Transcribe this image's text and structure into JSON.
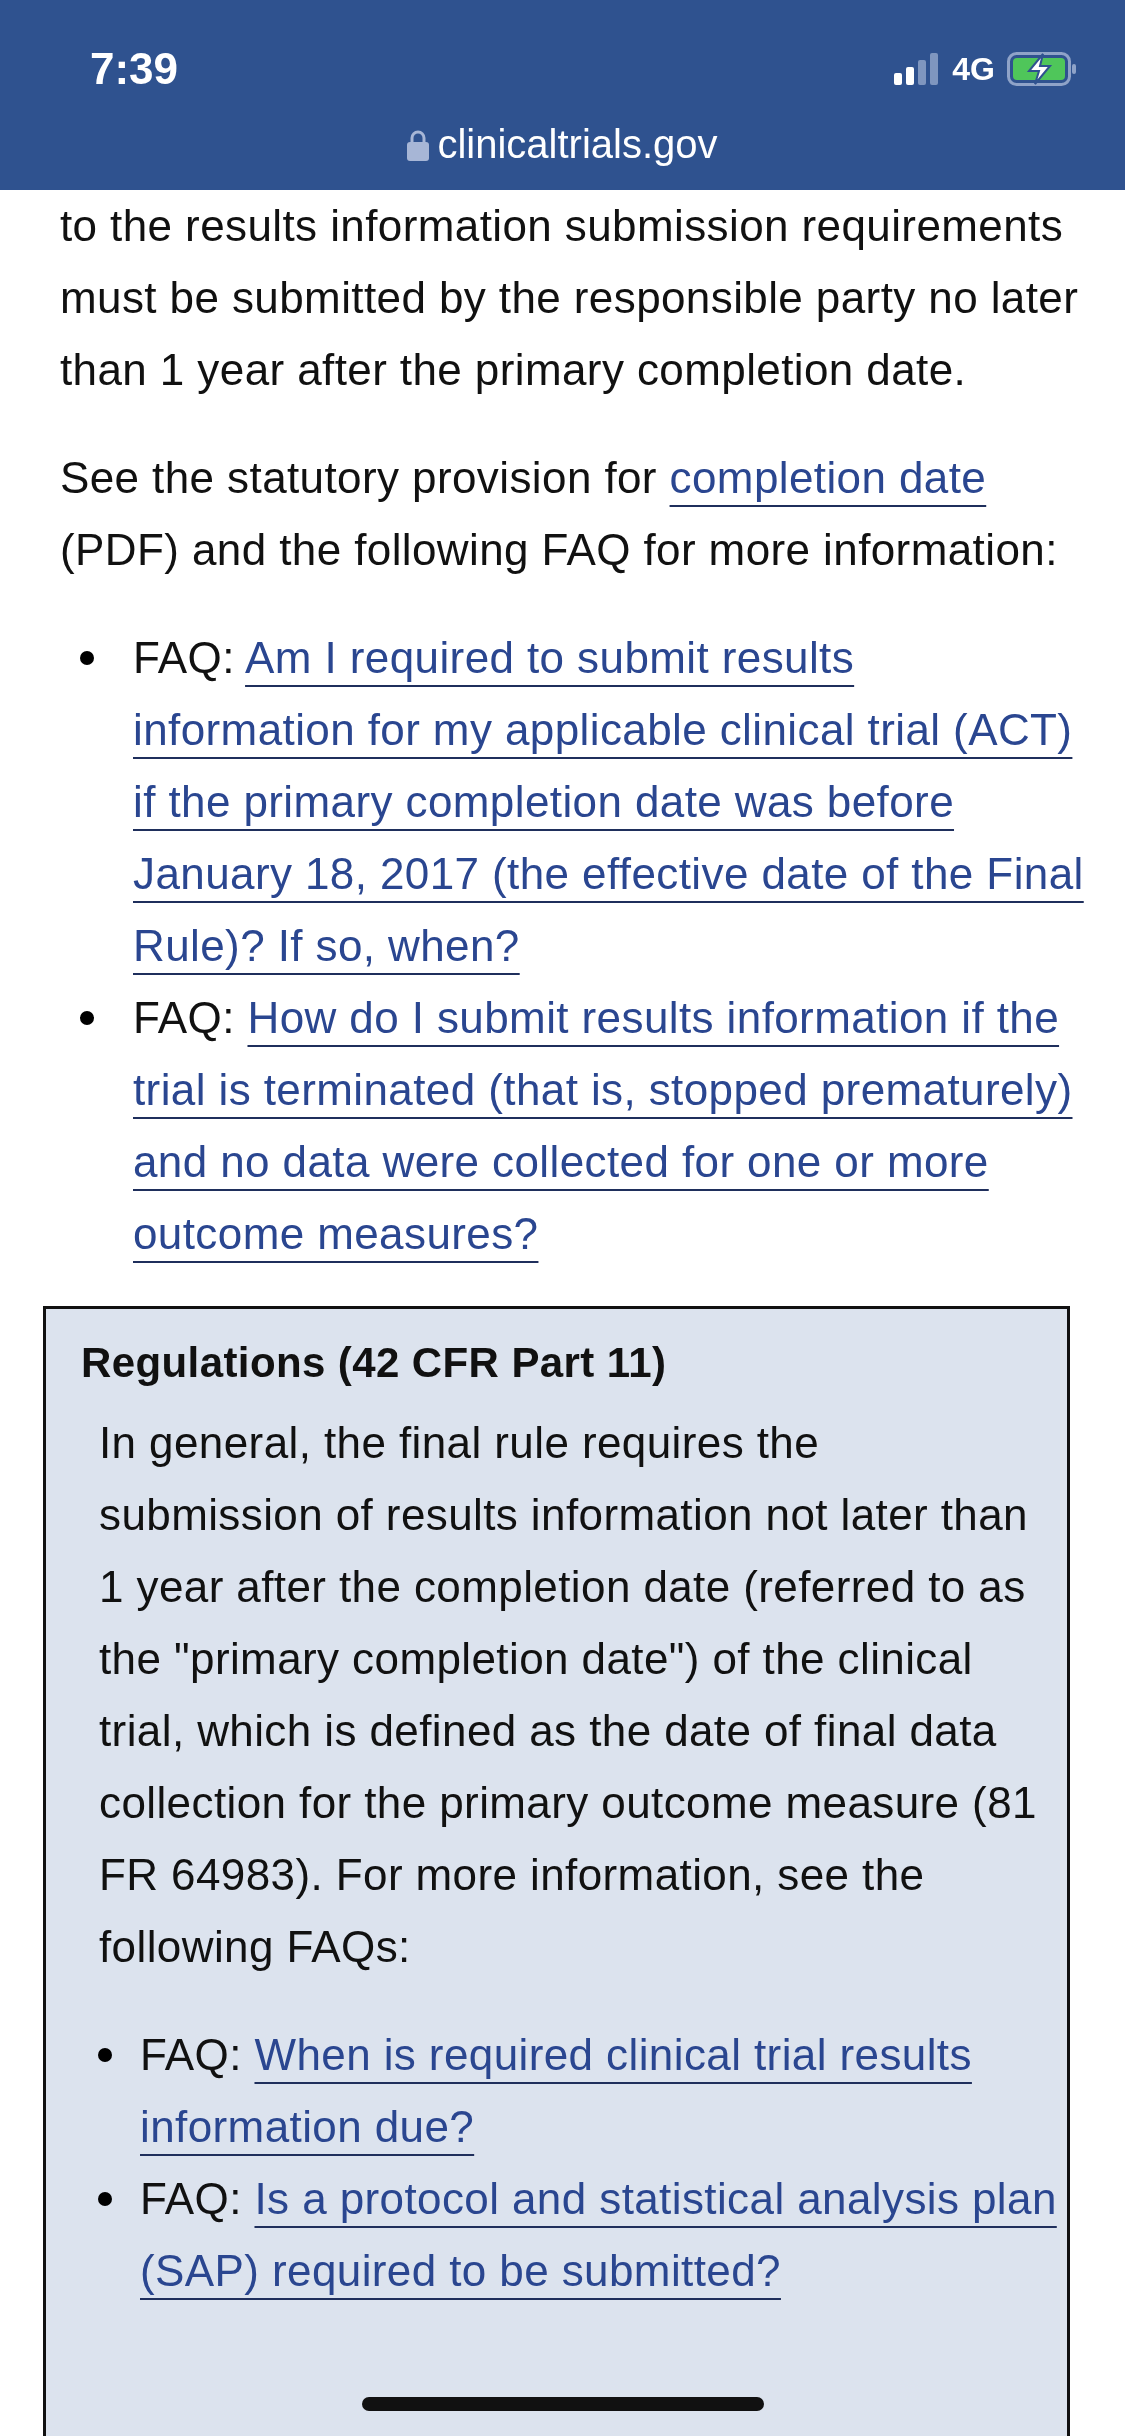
{
  "status_bar": {
    "time": "7:39",
    "network": "4G"
  },
  "address_bar": {
    "url": "clinicaltrials.gov"
  },
  "intro_paragraph": "to the results information submission requirements must be submitted by the responsible party no later than 1 year after the primary completion date.",
  "provision_paragraph": {
    "before": "See the statutory provision for ",
    "link": "completion date",
    "after": " (PDF) and the following FAQ for more information:"
  },
  "faq_list": [
    {
      "label": "FAQ:",
      "link": "Am I required to submit results information for my applicable clinical trial (ACT) if the primary completion date was before January 18, 2017 (the effective date of the Final Rule)? If so, when?"
    },
    {
      "label": "FAQ:",
      "link": "How do I submit results information if the trial is terminated (that is, stopped prematurely) and no data were collected for one or more outcome measures?"
    }
  ],
  "regulations_box": {
    "title": "Regulations (42 CFR Part 11)",
    "body": "In general, the final rule requires the submission of results information not later than 1 year after the completion date (referred to as the \"primary completion date\") of the clinical trial, which is defined as the date of final data collection for the primary outcome measure (81 FR 64983). For more information, see the following FAQs:",
    "faq_list": [
      {
        "label": "FAQ:",
        "link": "When is required clinical trial results information due?"
      },
      {
        "label": "FAQ:",
        "link": "Is a protocol and statistical analysis plan (SAP) required to be submitted?"
      }
    ]
  }
}
